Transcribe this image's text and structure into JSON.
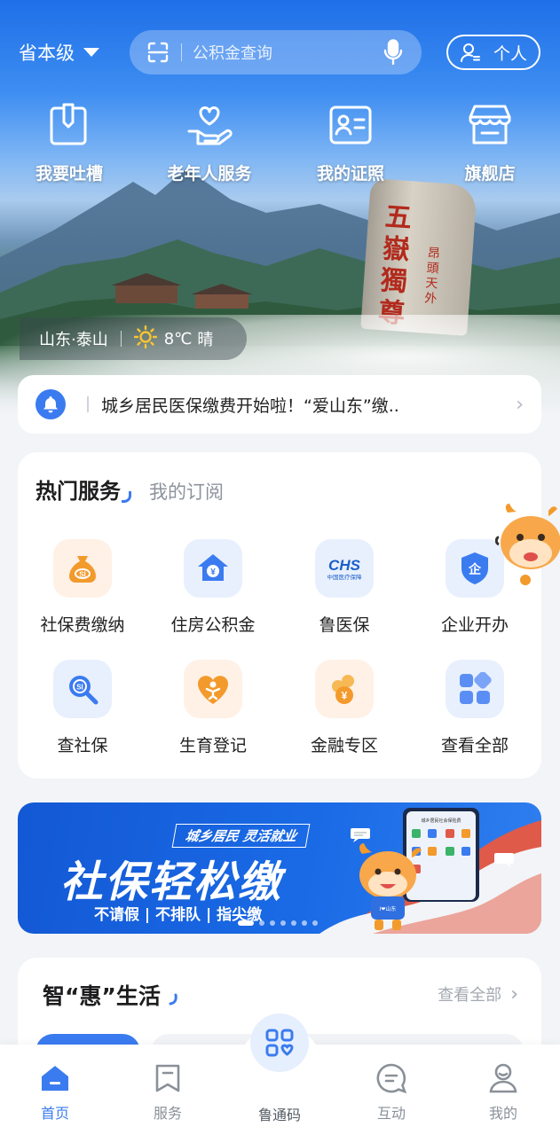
{
  "header": {
    "region": "省本级",
    "search_placeholder": "公积金查询",
    "personal_label": "个人"
  },
  "quick_actions": [
    {
      "label": "我要吐槽",
      "icon": "feedback-icon"
    },
    {
      "label": "老年人服务",
      "icon": "elderly-service-icon"
    },
    {
      "label": "我的证照",
      "icon": "id-card-icon"
    },
    {
      "label": "旗舰店",
      "icon": "store-icon"
    }
  ],
  "rock_inscription": {
    "main": "五嶽獨尊",
    "side": "昂頭天外"
  },
  "weather": {
    "location": "山东·泰山",
    "temperature": "8℃",
    "condition": "晴"
  },
  "notice": {
    "text": "城乡居民医保缴费开始啦！“爱山东”缴.."
  },
  "services": {
    "tabs": [
      "热门服务",
      "我的订阅"
    ],
    "active_tab": 0,
    "items": [
      {
        "label": "社保费缴纳",
        "icon": "money-bag-icon",
        "color": "#f39a2c"
      },
      {
        "label": "住房公积金",
        "icon": "house-fund-icon",
        "color": "#3b7bf0"
      },
      {
        "label": "鲁医保",
        "icon": "chs-medical-insurance-icon",
        "color": "#1b5fc9"
      },
      {
        "label": "企业开办",
        "icon": "enterprise-shield-icon",
        "color": "#3b7bf0"
      },
      {
        "label": "查社保",
        "icon": "search-social-security-icon",
        "color": "#3b7bf0"
      },
      {
        "label": "生育登记",
        "icon": "birth-registration-icon",
        "color": "#f39a2c"
      },
      {
        "label": "金融专区",
        "icon": "finance-coins-icon",
        "color": "#f39a2c"
      },
      {
        "label": "查看全部",
        "icon": "grid-all-icon",
        "color": "#5b8ef5"
      }
    ],
    "chs_logo_text": "CHS",
    "chs_logo_subtext": "中国医疗保障"
  },
  "banner": {
    "tag": "城乡居民 灵活就业",
    "headline": "社保轻松缴",
    "subline": "不请假 | 不排队 | 指尖缴",
    "mascot_shirt_text": "I❤山东",
    "phone_title": "城乡居民社会保险费",
    "active_slide": 0,
    "slide_count": 7
  },
  "smart_life": {
    "title": "智“惠”生活",
    "more_label": "查看全部"
  },
  "bottom_nav": {
    "items": [
      {
        "label": "首页",
        "icon": "home-icon",
        "active": true
      },
      {
        "label": "服务",
        "icon": "service-bookmark-icon",
        "active": false
      },
      {
        "label": "鲁通码",
        "icon": "qr-code-icon",
        "active": false
      },
      {
        "label": "互动",
        "icon": "chat-icon",
        "active": false
      },
      {
        "label": "我的",
        "icon": "profile-icon",
        "active": false
      }
    ]
  },
  "colors": {
    "accent": "#3b7bf0",
    "orange": "#f39a2c",
    "banner_blue": "#1358d4",
    "banner_red": "#e05a4a"
  }
}
